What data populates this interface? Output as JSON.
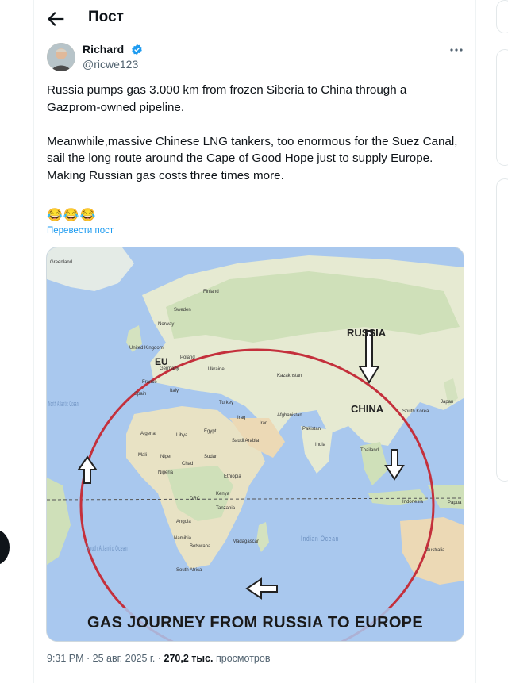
{
  "header": {
    "title": "Пост"
  },
  "post": {
    "author_name": "Richard",
    "author_handle": "@ricwe123",
    "text": "Russia pumps gas 3.000 km from frozen Siberia to China through a Gazprom-owned pipeline.\n\nMeanwhile,massive Chinese LNG tankers, too enormous for the Suez Canal, sail the long route around the Cape of Good Hope just to supply Europe.\nMaking Russian gas costs three times more.",
    "emojis": "😂😂😂",
    "translate_label": "Перевести пост",
    "time": "9:31 PM",
    "date": "25 авг. 2025 г.",
    "views_count": "270,2 тыс.",
    "views_label": "просмотров"
  },
  "map": {
    "caption": "GAS JOURNEY FROM RUSSIA TO EUROPE",
    "labels": {
      "russia": "RUSSIA",
      "china": "CHINA",
      "eu": "EU",
      "greenland": "Greenland",
      "finland": "Finland",
      "sweden": "Sweden",
      "norway": "Norway",
      "uk": "United Kingdom",
      "poland": "Poland",
      "germany": "Germany",
      "ukraine": "Ukraine",
      "france": "France",
      "spain": "Spain",
      "italy": "Italy",
      "kazakhstan": "Kazakhstan",
      "turkey": "Turkey",
      "iraq": "Iraq",
      "iran": "Iran",
      "afghanistan": "Afghanistan",
      "pakistan": "Pakistan",
      "india": "India",
      "saudi": "Saudi Arabia",
      "algeria": "Algeria",
      "libya": "Libya",
      "egypt": "Egypt",
      "mali": "Mali",
      "niger": "Niger",
      "chad": "Chad",
      "sudan": "Sudan",
      "nigeria": "Nigeria",
      "ethiopia": "Ethiopia",
      "kenya": "Kenya",
      "drc": "DRC",
      "tanzania": "Tanzania",
      "angola": "Angola",
      "namibia": "Namibia",
      "botswana": "Botswana",
      "madagascar": "Madagascar",
      "south_africa": "South Africa",
      "thailand": "Thailand",
      "south_korea": "South Korea",
      "japan": "Japan",
      "indonesia": "Indonesia",
      "papua": "Papua",
      "australia": "Australia",
      "north_atlantic": "North Atlantic Ocean",
      "south_atlantic": "South Atlantic Ocean",
      "indian_ocean": "Indian Ocean"
    }
  },
  "colors": {
    "accent": "#1d9bf0",
    "route": "#c4303c",
    "ocean": "#a9c8ee",
    "land": "#e8ecd6"
  }
}
